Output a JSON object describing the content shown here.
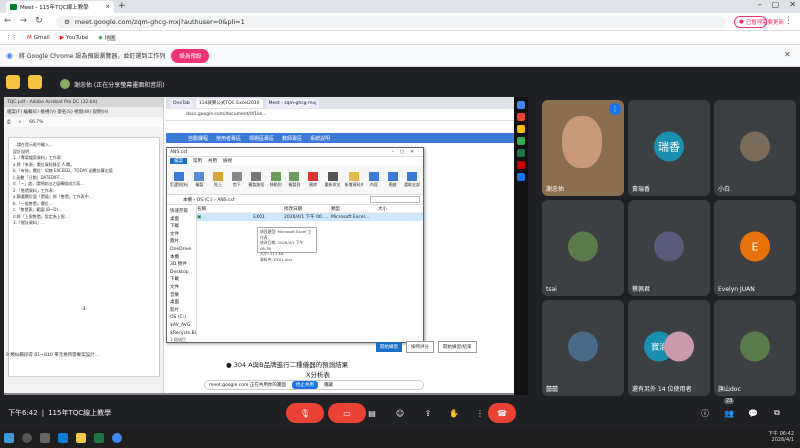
{
  "chrome": {
    "tab_title": "Meet - 115年TQC線上教學",
    "url": "meet.google.com/zqm-ghcg-mxj?authuser=0&pli=1",
    "pause_label": "已暫停",
    "update_label": "需要更新",
    "bookmarks": [
      "Gmail",
      "YouTube",
      "地圖"
    ],
    "info_text": "將 Google Chrome 設為預設瀏覽器，並釘選到工作列",
    "info_button": "設為預設"
  },
  "meet": {
    "presenter_text": "謝忠佑 (正在分享螢幕畫面和音訊)",
    "time": "下午6:42",
    "meeting_name": "115年TQC線上教學",
    "participants_count": "23"
  },
  "shared": {
    "acrobat_title": "TQC.pdf - Adobe Acrobat Pro DC (32-bit)",
    "acrobat_menu": "檔案(F)  編輯(E)  檢視(V)  簽名(S)  視窗(W)  說明(H)",
    "acrobat_zoom": "66.7%",
    "doc_lines": [
      "…請在提示框中輸入…",
      "設計說明：",
      "1.「專案檔案資料」工作表：",
      "a.將「來源」欄位資料移至 A 欄。",
      "b.「有效」欄位：如無 EXCEED、TODAY 函數計算出值",
      "c.函數「日期」DATEDIFF…",
      "d.「~」處，請將取出之值轉換成大寫…",
      "2.「售價資料」工作表：",
      "a.篩選欄位值「價值」與「售價」工作表中…",
      "b.「一般售價」欄位…",
      "c.「售價表」範圍 (B~D)…",
      "d.將「上限售價」設定為上限…",
      "3.「總計資料」…"
    ],
    "page_sep": "-3-",
    "acrobat_footer": "9.類似欄段得 B1~B10 單元格所需專案設計…",
    "b2_tabs": [
      "OneTab",
      "114試算公式TQC Excel2016",
      "Meet - zqm-ghcg-mxj"
    ],
    "b2_url": "docs.google.com/document/d/1ke...",
    "b2_menu": [
      "自動課程",
      "使用者專區",
      "標題區專區",
      "教師專區",
      "系統說明"
    ],
    "explorer_title": "ANS.csf",
    "explorer_tabs": [
      "檔案",
      "常用",
      "共用",
      "檢視"
    ],
    "ribbon": [
      "釘選到快速存取",
      "複製",
      "貼上",
      "剪下",
      "複製路徑",
      "移動到",
      "複製到",
      "刪除",
      "重新命名",
      "新增資料夾",
      "內容",
      "開啟",
      "選取全部"
    ],
    "path": "本機 › OS (C:) › ANS.csf",
    "nav_items": [
      "快速存取",
      "桌面",
      "下載",
      "文件",
      "圖片",
      "OneDrive",
      "本機",
      "3D 物件",
      "Desktop",
      "下載",
      "文件",
      "音樂",
      "桌面",
      "影片",
      "OS (C:)",
      "$AV_AVG",
      "$Recycle.Bin",
      "$WINDOWS.~BT",
      "$WinREAgent"
    ],
    "col_headers": [
      "名稱",
      "修改日期",
      "類型",
      "大小"
    ],
    "file": {
      "name": "EX01",
      "date": "2026/4/1 下午 06:…",
      "type": "Microsoft Excel…",
      "size": ""
    },
    "tooltip": [
      "項目類型: Microsoft Excel 工作表",
      "修改日期: 2026/4/1 下午 06:36",
      "大小: 213 KB",
      "資料夾: EX01.xlsx"
    ],
    "status": "1 個項目",
    "xl_buttons": [
      "開始練習",
      "按時評分",
      "開始練習/結束"
    ],
    "slide_bullet": "● 304 A與B品牌進行二種儀器的預測結果",
    "slide_line2": "X分析表",
    "share_text": "meet.google.com 正在共用你的畫面",
    "stop_share": "停止共用",
    "hide": "隱藏",
    "screen_clock": "下午 06:42\n2026/4/1"
  },
  "tiles": [
    {
      "name": "謝忠佑",
      "type": "video"
    },
    {
      "name": "黃瑞香",
      "type": "avatar",
      "text": "瑞香",
      "color": "#1a8fb0"
    },
    {
      "name": "小白",
      "type": "image"
    },
    {
      "name": "tsai",
      "type": "image"
    },
    {
      "name": "蔡佩君",
      "type": "image"
    },
    {
      "name": "Evelyn JUAN",
      "type": "avatar",
      "text": "E",
      "color": "#e8710a"
    },
    {
      "name": "囍囍",
      "type": "image"
    },
    {
      "name": "還有另外 14 位使用者",
      "type": "group",
      "text": "寶治"
    },
    {
      "name": "旗山doc",
      "type": "image"
    }
  ],
  "taskbar": {
    "time": "下午 06:42",
    "date": "2026/4/1"
  }
}
